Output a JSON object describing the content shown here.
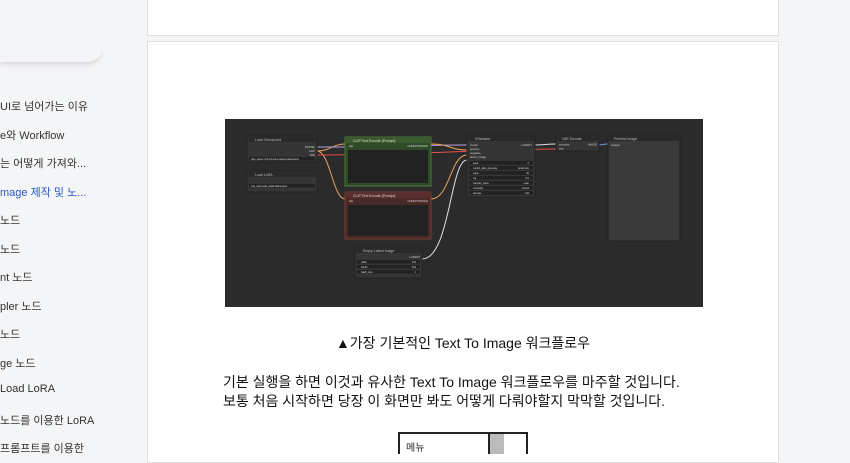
{
  "sidebar": {
    "items": [
      {
        "label": "UI로 넘어가는 이유",
        "active": false
      },
      {
        "label": "e와 Workflow",
        "active": false
      },
      {
        "label": "는 어떻게 가져와...",
        "active": false
      },
      {
        "label": "mage 제작 및 노...",
        "active": true
      },
      {
        "label": "노드",
        "active": false
      },
      {
        "label": " 노드",
        "active": false
      },
      {
        "label": "nt 노드",
        "active": false
      },
      {
        "label": "pler 노드",
        "active": false
      },
      {
        "label": " 노드",
        "active": false
      },
      {
        "label": "ge 노드",
        "active": false
      },
      {
        "label": "Load LoRA",
        "active": false
      },
      {
        "label": "노드를 이용한 LoRA",
        "active": false
      },
      {
        "label": "프롬프트를 이용한",
        "active": false
      }
    ]
  },
  "workflow": {
    "nodes": {
      "checkpoint": {
        "title": "Load Checkpoint",
        "model": "MODEL",
        "clip": "CLIP",
        "vae": "VAE",
        "ckpt": "ckpt_name  v1-5-pruned-emaonly.safetensors"
      },
      "lora": {
        "title": "Load LoRA",
        "lora": "lora_name  add_detail.safetensors"
      },
      "pos": {
        "title": "CLIP Text Encode (Prompt)",
        "in": "clip",
        "out": "CONDITIONING"
      },
      "neg": {
        "title": "CLIP Text Encode (Prompt)",
        "in": "clip",
        "out": "CONDITIONING"
      },
      "latent": {
        "title": "Empty Latent Image",
        "out": "LATENT",
        "w": "width",
        "wv": "512",
        "h": "height",
        "hv": "512",
        "b": "batch_size",
        "bv": "1"
      },
      "ksampler": {
        "title": "KSampler",
        "ins": [
          "model",
          "positive",
          "negative",
          "latent_image"
        ],
        "out": "LATENT",
        "rows": [
          [
            "seed",
            "0"
          ],
          [
            "control_after_generate",
            "randomize"
          ],
          [
            "steps",
            "20"
          ],
          [
            "cfg",
            "8.0"
          ],
          [
            "sampler_name",
            "euler"
          ],
          [
            "scheduler",
            "normal"
          ],
          [
            "denoise",
            "1.00"
          ]
        ]
      },
      "vae": {
        "title": "VAE Decode",
        "ins": [
          "samples",
          "vae"
        ],
        "out": "IMAGE"
      },
      "preview": {
        "title": "Preview Image",
        "in": "images"
      }
    }
  },
  "caption": "▲가장 기본적인 Text To Image 워크플로우",
  "body": {
    "line1": "기본 실행을 하면 이것과 유사한 Text To Image 워크플로우를 마주할 것입니다.",
    "line2": "보통 처음 시작하면 당장 이 화면만 봐도 어떻게 다뤄야할지 막막할 것입니다."
  },
  "thumb": {
    "label": "메뉴"
  },
  "colors": {
    "link_active": "#2b55c8",
    "wf_bg": "#2b2b2b",
    "node_bg": "#353535",
    "pos_border": "#4a7a3c",
    "neg_border": "#7a3b38"
  }
}
